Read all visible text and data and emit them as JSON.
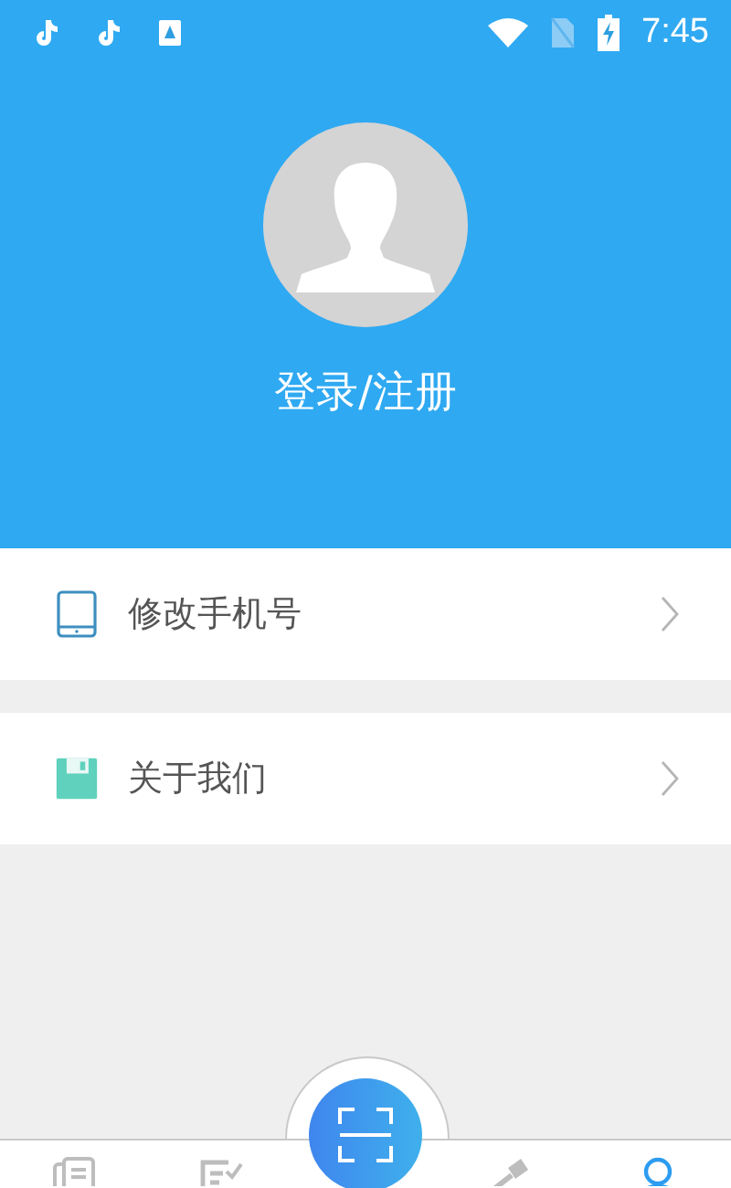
{
  "status_bar": {
    "time": "7:45"
  },
  "profile": {
    "login_label": "登录/注册"
  },
  "menu": [
    {
      "kind": "phone",
      "label": "修改手机号"
    },
    {
      "kind": "about",
      "label": "关于我们"
    }
  ],
  "bottom_nav": [
    {
      "kind": "documents",
      "selected": false
    },
    {
      "kind": "checklist",
      "selected": false
    },
    {
      "kind": "scan",
      "selected": false
    },
    {
      "kind": "gavel",
      "selected": false
    },
    {
      "kind": "profile",
      "selected": true
    }
  ]
}
